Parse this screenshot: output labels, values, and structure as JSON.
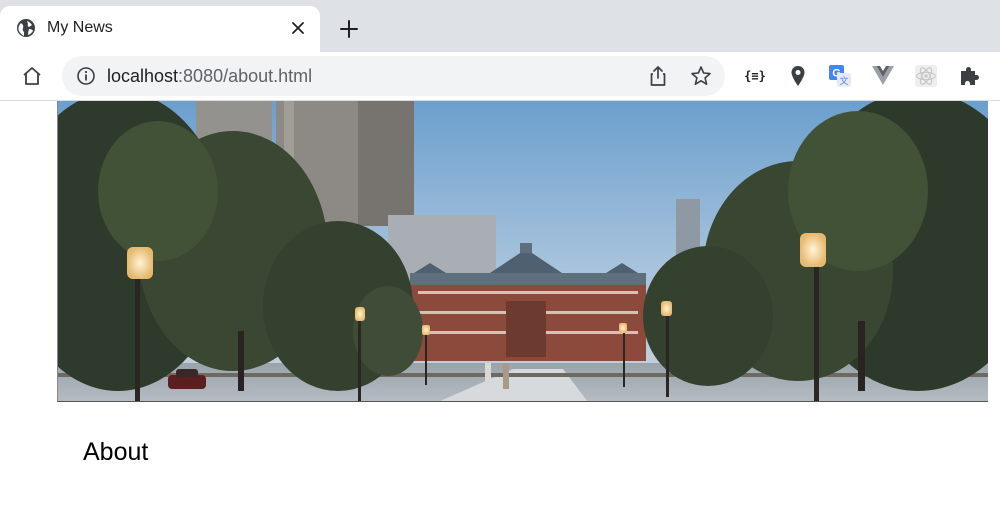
{
  "browser": {
    "tab": {
      "title": "My News",
      "favicon": "globe-icon",
      "close_icon": "close-icon"
    },
    "new_tab_icon": "plus-icon",
    "toolbar": {
      "home_icon": "home-icon",
      "omnibox": {
        "info_icon": "info-icon",
        "url_host": "localhost",
        "url_rest": ":8080/about.html",
        "share_icon": "share-icon",
        "bookmark_icon": "star-icon"
      },
      "extensions": [
        {
          "name": "json-formatter-extension",
          "label": "{≡}"
        },
        {
          "name": "maps-pin-extension"
        },
        {
          "name": "google-translate-extension"
        },
        {
          "name": "vue-devtools-extension"
        },
        {
          "name": "react-devtools-extension"
        },
        {
          "name": "extensions-puzzle"
        }
      ]
    }
  },
  "page": {
    "hero_image_description": "photo",
    "heading": "About"
  },
  "colors": {
    "tabstrip_bg": "#dee1e6",
    "omnibox_bg": "#f1f3f4",
    "text_primary": "#202124",
    "text_secondary": "#5f6368"
  }
}
